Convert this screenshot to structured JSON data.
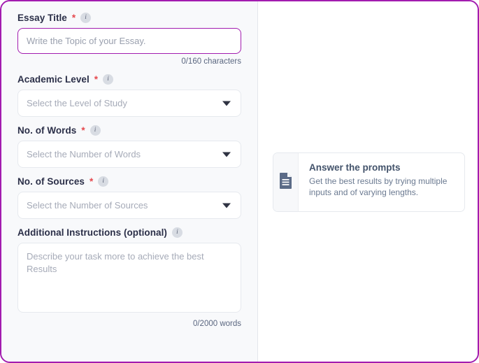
{
  "form": {
    "fields": [
      {
        "id": "essay-title",
        "label": "Essay Title",
        "required_marker": "*",
        "optional_suffix": "",
        "info_glyph": "i",
        "type": "text",
        "value": "",
        "placeholder": "Write the Topic of your Essay.",
        "counter": "0/160 characters",
        "focused": true
      },
      {
        "id": "academic-level",
        "label": "Academic Level",
        "required_marker": "*",
        "info_glyph": "i",
        "type": "select",
        "value": "",
        "placeholder": "Select the Level of Study"
      },
      {
        "id": "no-of-words",
        "label": "No. of Words",
        "required_marker": "*",
        "info_glyph": "i",
        "type": "select",
        "value": "",
        "placeholder": "Select the Number of Words"
      },
      {
        "id": "no-of-sources",
        "label": "No. of Sources",
        "required_marker": "*",
        "info_glyph": "i",
        "type": "select",
        "value": "",
        "placeholder": "Select the Number of Sources"
      },
      {
        "id": "additional-instructions",
        "label": "Additional Instructions (optional)",
        "required_marker": "",
        "info_glyph": "i",
        "type": "textarea",
        "value": "",
        "placeholder": "Describe your task more to achieve the best Results",
        "counter": "0/2000 words"
      }
    ]
  },
  "result_panel": {
    "hint_card": {
      "icon": "document-icon",
      "title": "Answer the prompts",
      "description": "Get the best results by trying multiple inputs and of varying lengths."
    }
  },
  "colors": {
    "frame_border": "#a21caf",
    "focus_border": "#a21caf",
    "required_star": "#e5484d",
    "label_text": "#2b2f48",
    "placeholder": "#a6abb8",
    "counter_text": "#5b6780",
    "panel_bg": "#f8f9fb",
    "hint_icon": "#5b6b87"
  }
}
